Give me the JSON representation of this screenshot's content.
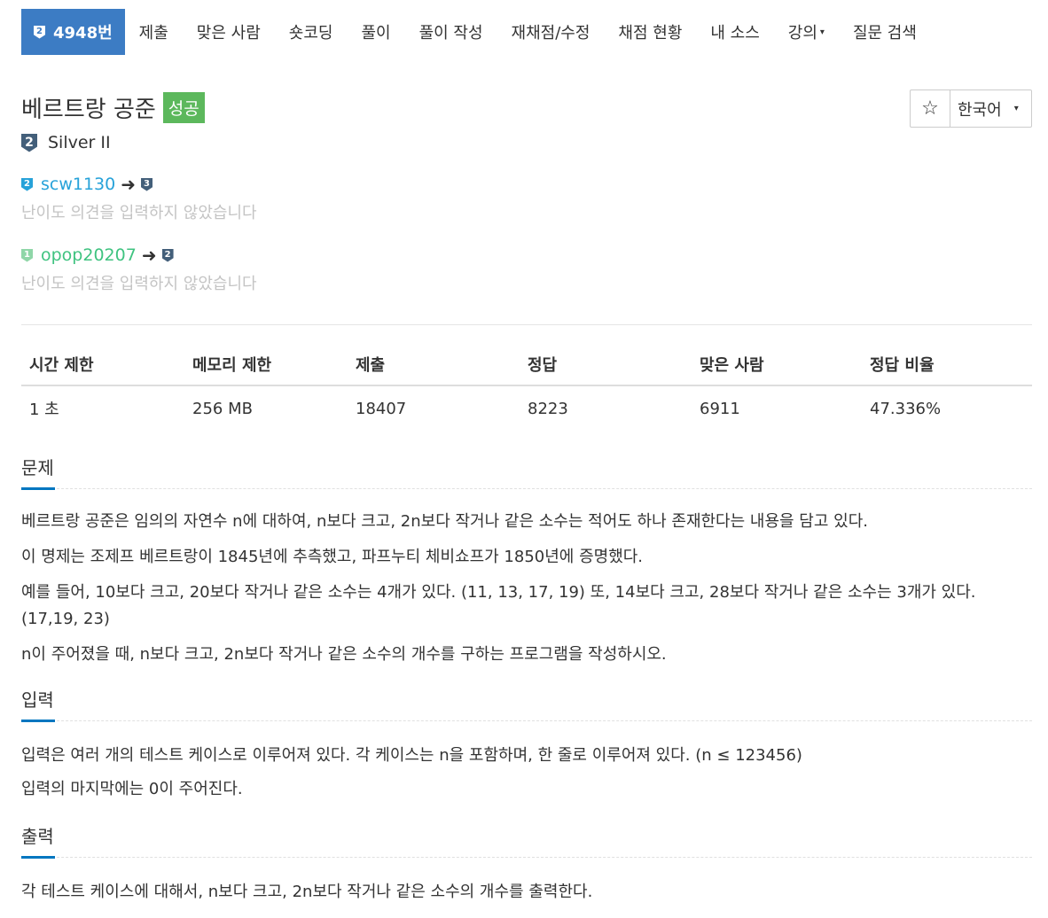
{
  "nav": {
    "active": {
      "tier": "2",
      "label": "4948번"
    },
    "items": [
      "제출",
      "맞은 사람",
      "숏코딩",
      "풀이",
      "풀이 작성",
      "재채점/수정",
      "채점 현황",
      "내 소스"
    ],
    "lecture": "강의",
    "search": "질문 검색"
  },
  "problem": {
    "title": "베르트랑 공준",
    "status": "성공"
  },
  "tools": {
    "star": "☆",
    "language": "한국어"
  },
  "tier": {
    "level": "2",
    "name": "Silver II"
  },
  "opinions": [
    {
      "user": "scw1130",
      "from_tier": "2",
      "to_tier": "3",
      "note": "난이도 의견을 입력하지 않았습니다"
    },
    {
      "user": "opop20207",
      "from_tier": "1",
      "to_tier": "2",
      "note": "난이도 의견을 입력하지 않았습니다"
    }
  ],
  "info": {
    "headers": [
      "시간 제한",
      "메모리 제한",
      "제출",
      "정답",
      "맞은 사람",
      "정답 비율"
    ],
    "values": [
      "1 초",
      "256 MB",
      "18407",
      "8223",
      "6911",
      "47.336%"
    ]
  },
  "sections": {
    "problem": {
      "title": "문제",
      "paragraphs": [
        "베르트랑 공준은 임의의 자연수 n에 대하여, n보다 크고, 2n보다 작거나 같은 소수는 적어도 하나 존재한다는 내용을 담고 있다.",
        "이 명제는 조제프 베르트랑이 1845년에 추측했고, 파프누티 체비쇼프가 1850년에 증명했다.",
        "예를 들어, 10보다 크고, 20보다 작거나 같은 소수는 4개가 있다. (11, 13, 17, 19) 또, 14보다 크고, 28보다 작거나 같은 소수는 3개가 있다. (17,19, 23)",
        "n이 주어졌을 때, n보다 크고, 2n보다 작거나 같은 소수의 개수를 구하는 프로그램을 작성하시오."
      ]
    },
    "input": {
      "title": "입력",
      "paragraphs": [
        "입력은 여러 개의 테스트 케이스로 이루어져 있다. 각 케이스는 n을 포함하며, 한 줄로 이루어져 있다. (n ≤ 123456)",
        "입력의 마지막에는 0이 주어진다."
      ]
    },
    "output": {
      "title": "출력",
      "paragraphs": [
        "각 테스트 케이스에 대해서, n보다 크고, 2n보다 작거나 같은 소수의 개수를 출력한다."
      ]
    }
  },
  "colors": {
    "nav_active": "#3c7cc4",
    "success": "#5cb85c",
    "silver": "#435f7a",
    "bronze_silver_user": "#27a2d9",
    "bronze_user": "#3fc380",
    "section_underline": "#0076c0"
  }
}
